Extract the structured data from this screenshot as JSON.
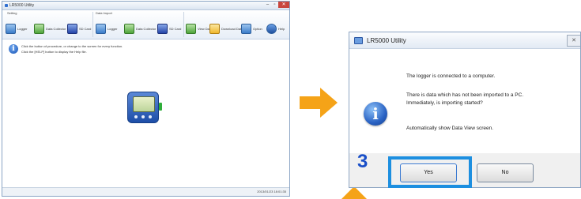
{
  "app": {
    "title": "LR5000 Utility",
    "group_setting": "Setting",
    "group_data": "Data Import",
    "btn_logger": "Logger",
    "btn_data_collector": "Data Collector",
    "btn_sd_card": "SD Card",
    "btn_logger2": "Logger",
    "btn_data_collector2": "Data Collector",
    "btn_sd_card2": "SD Card",
    "btn_view": "View Data",
    "btn_download": "Download Data",
    "btn_option": "Option",
    "btn_help": "Help",
    "info_line1": "Click the button of procedure, or change to the screen for every function.",
    "info_line2": "Click the [HELP] button to display the Help file.",
    "status_time": "2013/01/23 18:01:35"
  },
  "dialog": {
    "title": "LR5000 Utility",
    "close_glyph": "✕",
    "line1": "The logger is connected to a computer.",
    "line2": "There is data which has not been imported to a PC.",
    "line3": "Immediately, is importing started?",
    "line4": "Automatically show Data View screen.",
    "yes_label": "Yes",
    "no_label": "No"
  },
  "step_number": "3",
  "colors": {
    "arrow": "#f5a318",
    "highlight": "#1d8fe0",
    "step_number": "#1a4fc8"
  }
}
